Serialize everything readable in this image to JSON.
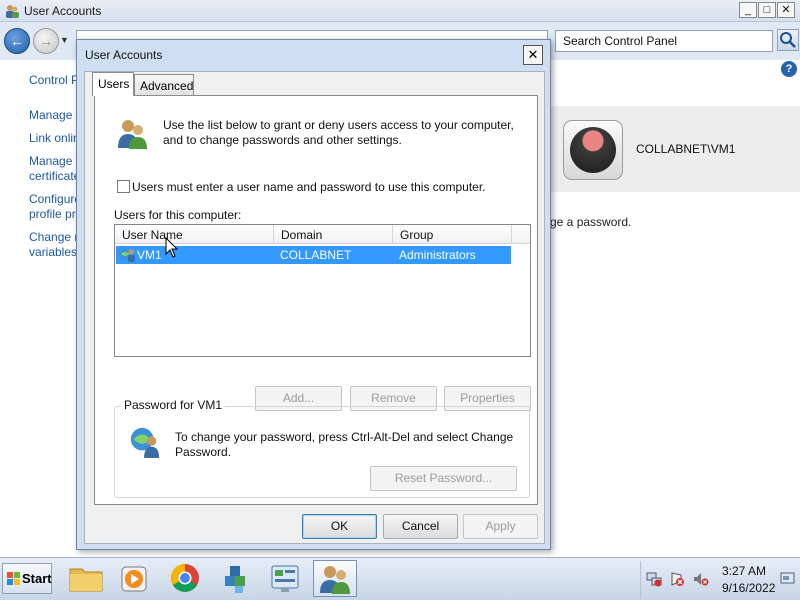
{
  "window": {
    "title": "User Accounts",
    "search_placeholder": "Search Control Panel",
    "minimize": "_",
    "maximize": "□",
    "close": "✕"
  },
  "nav": {
    "back": "←",
    "forward": "→",
    "drop": "▼"
  },
  "help": "?",
  "sidebar": {
    "links": [
      "Control Panel Home",
      "Manage your credentials",
      "Link online IDs",
      "Manage your file encryption",
      "certificates",
      "Configure advanced user",
      "profile properties",
      "Change my environment",
      "variables"
    ]
  },
  "account_panel": {
    "name": "COLLABNET\\VM1",
    "hint": "ge a password."
  },
  "dialog": {
    "title": "User Accounts",
    "close": "✕",
    "tabs": [
      "Users",
      "Advanced"
    ],
    "intro": "Use the list below to grant or deny users access to your computer, and to change passwords and other settings.",
    "checkbox_label": "Users must enter a user name and password to use this computer.",
    "checkbox_checked": false,
    "list_label": "Users for this computer:",
    "columns": [
      "User Name",
      "Domain",
      "Group"
    ],
    "rows": [
      {
        "user": "VM1",
        "domain": "COLLABNET",
        "group": "Administrators",
        "selected": true
      }
    ],
    "buttons": {
      "add": "Add...",
      "remove": "Remove",
      "properties": "Properties"
    },
    "password_group_label": "Password for VM1",
    "password_text": "To change your password, press Ctrl-Alt-Del and select Change Password.",
    "reset_button": "Reset Password...",
    "ok": "OK",
    "cancel": "Cancel",
    "apply": "Apply"
  },
  "taskbar": {
    "start": "Start",
    "apps": [
      "file-explorer-icon",
      "media-player-icon",
      "chrome-icon",
      "cubes-app-icon",
      "control-panel-icon",
      "user-accounts-icon"
    ],
    "time": "3:27 AM",
    "date": "9/16/2022"
  },
  "colors": {
    "selection": "#3399ff",
    "link": "#1d5aa6"
  }
}
